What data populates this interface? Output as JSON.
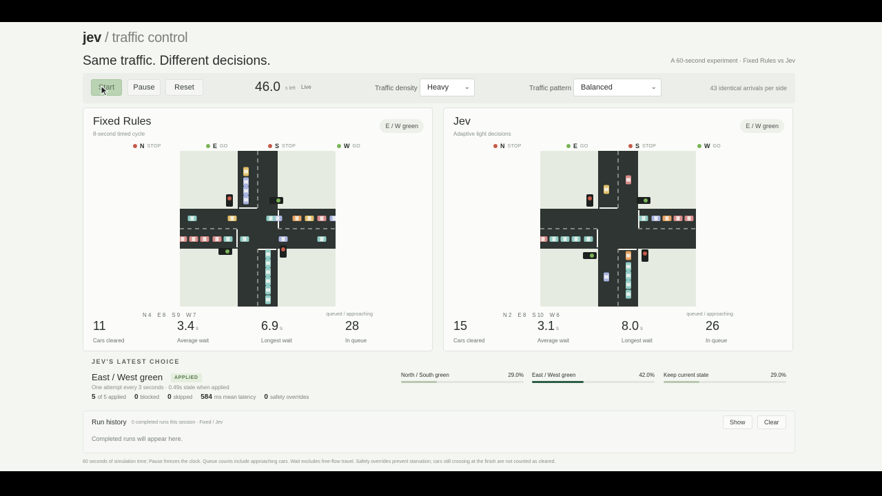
{
  "header": {
    "brand_bold": "jev",
    "brand_rest": " / traffic control",
    "tagline": "Same traffic. Different decisions.",
    "tagline_right": "A 60-second experiment · Fixed Rules vs Jev"
  },
  "toolbar": {
    "start_label": "Start",
    "pause_label": "Pause",
    "reset_label": "Reset",
    "timer_value": "46.0",
    "timer_unit": "s left",
    "live_label": "Live",
    "density_label": "Traffic density",
    "density_value": "Heavy",
    "pattern_label": "Traffic pattern",
    "pattern_value": "Balanced",
    "arrivals_note": "43 identical arrivals per side"
  },
  "panels": [
    {
      "title": "Fixed Rules",
      "subtitle": "8-second timed cycle",
      "badge": "E / W green",
      "signals": [
        {
          "dir": "N",
          "state": "STOP",
          "color": "#c65a4a"
        },
        {
          "dir": "E",
          "state": "GO",
          "color": "#79b356"
        },
        {
          "dir": "S",
          "state": "STOP",
          "color": "#c65a4a"
        },
        {
          "dir": "W",
          "state": "GO",
          "color": "#79b356"
        }
      ],
      "counts": "N 4    E 8    S 9    W 7",
      "queued_label": "queued / approaching",
      "stats": [
        {
          "value": "11",
          "unit": "",
          "label": "Cars cleared"
        },
        {
          "value": "3.4",
          "unit": "s",
          "label": "Average wait"
        },
        {
          "value": "6.9",
          "unit": "s",
          "label": "Longest wait"
        },
        {
          "value": "28",
          "unit": "",
          "label": "In queue"
        }
      ]
    },
    {
      "title": "Jev",
      "subtitle": "Adaptive light decisions",
      "badge": "E / W green",
      "signals": [
        {
          "dir": "N",
          "state": "STOP",
          "color": "#c65a4a"
        },
        {
          "dir": "E",
          "state": "GO",
          "color": "#79b356"
        },
        {
          "dir": "S",
          "state": "STOP",
          "color": "#c65a4a"
        },
        {
          "dir": "W",
          "state": "GO",
          "color": "#79b356"
        }
      ],
      "counts": "N 2    E 8    S 10    W 6",
      "queued_label": "queued / approaching",
      "stats": [
        {
          "value": "15",
          "unit": "",
          "label": "Cars cleared"
        },
        {
          "value": "3.1",
          "unit": "s",
          "label": "Average wait"
        },
        {
          "value": "8.0",
          "unit": "s",
          "label": "Longest wait"
        },
        {
          "value": "26",
          "unit": "",
          "label": "In queue"
        }
      ]
    }
  ],
  "choice": {
    "heading": "JEV'S LATEST CHOICE",
    "title": "East / West green",
    "badge": "APPLIED",
    "subtitle": "One attempt every 3 seconds · 0.49s stale when applied",
    "stats": [
      {
        "value": "5",
        "label": "of 5 applied"
      },
      {
        "value": "0",
        "label": "blocked"
      },
      {
        "value": "0",
        "label": "skipped"
      },
      {
        "value": "584",
        "label": "ms mean latency"
      },
      {
        "value": "0",
        "label": "safety overrides"
      }
    ],
    "options": [
      {
        "label": "North / South green",
        "value": "29.0%",
        "fraction": 0.29,
        "best": false
      },
      {
        "label": "East / West green",
        "value": "42.0%",
        "fraction": 0.42,
        "best": true
      },
      {
        "label": "Keep current state",
        "value": "29.0%",
        "fraction": 0.29,
        "best": false
      }
    ]
  },
  "history": {
    "title": "Run history",
    "subtitle": "0 completed runs this session · Fixed / Jev",
    "empty": "Completed runs will appear here.",
    "show_label": "Show",
    "clear_label": "Clear"
  },
  "footnote": "60 seconds of simulation time; Pause freezes the clock. Queue counts include approaching cars. Wait excludes free-flow travel. Safety overrides prevent starvation; cars still crossing at the finish are not counted as cleared.",
  "colors": {
    "road": "#2e3532",
    "ground": "#e6ebe2",
    "accent": "#2d5e45",
    "car_palette": [
      "#e3c06a",
      "#d98a8a",
      "#a9b3e0",
      "#8fcbc4",
      "#e8a15f"
    ]
  }
}
